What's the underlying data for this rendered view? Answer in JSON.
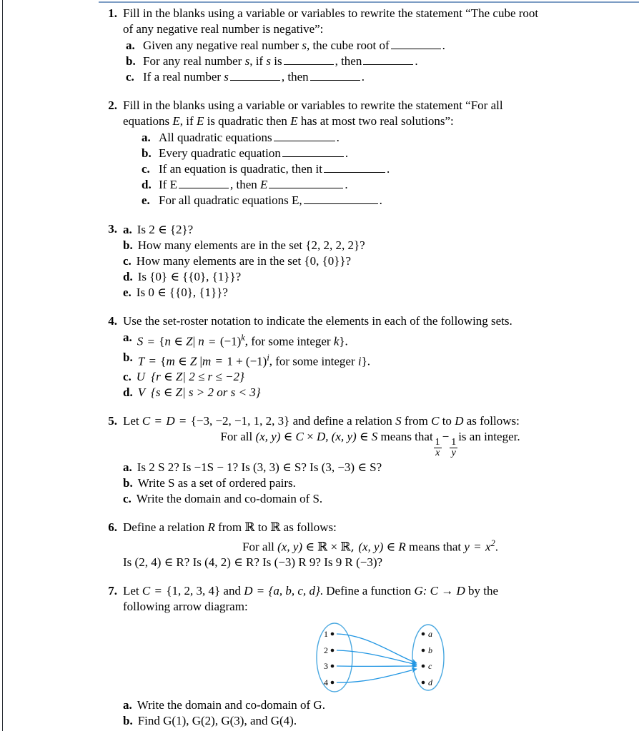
{
  "document": {
    "type": "math-worksheet",
    "rule_color": "#7d9dc4",
    "diagram_color": "#4aa8e0",
    "arrow_color": "#2196e3"
  },
  "problems": [
    {
      "number": "1.",
      "stem_line1": "Fill in the blanks using a variable or variables to rewrite the statement “The cube root",
      "stem_line2": "of any negative real number is negative”:",
      "parts": [
        {
          "label": "a.",
          "pre": "Given any negative real number",
          "var1": "s",
          "mid": ", the cube root of",
          "post": "."
        },
        {
          "label": "b.",
          "pre": "For any real number",
          "var1": "s",
          "mid": ", if",
          "var2": "s",
          "mid2": "is",
          "join": ", then",
          "post": "."
        },
        {
          "label": "c.",
          "pre": "If a real number",
          "var1": "s",
          "join": ", then",
          "post": "."
        }
      ]
    },
    {
      "number": "2.",
      "stem_line1": "Fill in the blanks using a variable or variables to rewrite the statement “For all",
      "stem_line2_a": "equations",
      "stem_line2_var1": "E",
      "stem_line2_b": ", if",
      "stem_line2_var2": "E",
      "stem_line2_c": "is quadratic then",
      "stem_line2_var3": "E",
      "stem_line2_d": "has at most two real solutions”:",
      "parts": [
        {
          "label": "a.",
          "text": "All quadratic equations",
          "post": "."
        },
        {
          "label": "b.",
          "text": "Every quadratic equation",
          "post": "."
        },
        {
          "label": "c.",
          "text": "If an equation is quadratic, then it",
          "post": "."
        },
        {
          "label": "d.",
          "text": "If E",
          "mid": ", then",
          "var": "E",
          "post": "."
        },
        {
          "label": "e.",
          "text": "For all quadratic equations E,",
          "post": "."
        }
      ]
    },
    {
      "number": "3.",
      "parts": [
        {
          "label": "a.",
          "text": "Is 2  ∈  {2}?"
        },
        {
          "label": "b.",
          "text": "How many elements are in the set {2, 2, 2, 2}?"
        },
        {
          "label": "c.",
          "text": "How many elements are in the set {0, {0}}?"
        },
        {
          "label": "d.",
          "text": "Is {0}  ∈  {{0}, {1}}?"
        },
        {
          "label": "e.",
          "text": "Is 0  ∈  {{0}, {1}}?"
        }
      ]
    },
    {
      "number": "4.",
      "stem": "Use the set-roster notation to indicate the elements in each of the following sets.",
      "parts": [
        {
          "label": "a.",
          "set": "S",
          "body_pre": "{",
          "elem": "n",
          "in": "∈",
          "univ": "Z",
          "bar": "|",
          "elem2": "n",
          "eq": "=",
          "expr": "(−1)",
          "exp": "k",
          "tail": ", for some integer",
          "tailvar": "k",
          "close": "}."
        },
        {
          "label": "b.",
          "set": "T",
          "body_pre": "{",
          "elem": "m",
          "in": "∈",
          "univ": "Z",
          "bar": "|",
          "elem2": "m",
          "eq": "=",
          "expr": "1 + (−1)",
          "exp": "i",
          "tail": ", for some integer",
          "tailvar": "i",
          "close": "}."
        },
        {
          "label": "c.",
          "set": "U",
          "body": "{r ∈ Z| 2 ≤ r ≤ −2}"
        },
        {
          "label": "d.",
          "set": "V",
          "body": "{s ∈ Z| s > 2 or s < 3}"
        }
      ]
    },
    {
      "number": "5.",
      "stem_a": "Let",
      "stem_C": "C",
      "stem_eq1": "=",
      "stem_D": "D",
      "stem_eq2": "=",
      "stem_set": "{−3, −2, −1, 1, 2, 3}",
      "stem_b": "and define a relation",
      "stem_S": "S",
      "stem_c": "from",
      "stem_C2": "C",
      "stem_d": "to",
      "stem_D2": "D",
      "stem_e": "as follows:",
      "centered_pre": "For all",
      "centered_pair": "(x, y)",
      "centered_in1": "∈",
      "centered_C": "C",
      "centered_times": "×",
      "centered_D": "D, ",
      "centered_pair2": "(x, y)",
      "centered_in2": "∈",
      "centered_S": "S",
      "centered_means": "means that",
      "frac1_num": "1",
      "frac1_den": "x",
      "frac_minus": "−",
      "frac2_num": "1",
      "frac2_den": "y",
      "centered_tail": "is an integer.",
      "parts": [
        {
          "label": "a.",
          "text": "Is 2 S 2? Is −1S  −  1? Is (3, 3)  ∈  S? Is (3, −3)  ∈  S?"
        },
        {
          "label": "b.",
          "text": "Write S as a set of ordered pairs."
        },
        {
          "label": "c.",
          "text": "Write the domain and co-domain of S."
        }
      ]
    },
    {
      "number": "6.",
      "stem_a": "Define a relation",
      "stem_R": "R",
      "stem_b": "from",
      "stem_RR1": "ℝ",
      "stem_c": "to",
      "stem_RR2": "ℝ",
      "stem_d": "as follows:",
      "centered_pre": "For all",
      "centered_pair": "(x, y)",
      "centered_in1": "∈",
      "centered_RR1": "ℝ",
      "centered_times": "×",
      "centered_RR2": "ℝ, ",
      "centered_pair2": "(x, y)",
      "centered_in2": "∈",
      "centered_R": "R",
      "centered_means": "means that",
      "centered_y": "y",
      "centered_eq": "=",
      "centered_x": "x",
      "centered_sup": "2",
      "centered_period": ".",
      "last_line": "Is (2, 4)  ∈  R? Is (4, 2)  ∈  R? Is (−3) R 9? Is 9 R (−3)?"
    },
    {
      "number": "7.",
      "stem_a": "Let",
      "stem_C": "C",
      "stem_eq1": "=",
      "stem_setC": "{1, 2, 3, 4}",
      "stem_and": "and",
      "stem_D": "D",
      "stem_eq2": "=",
      "stem_setD": "{a, b, c, d}",
      "stem_b": ". Define a function",
      "stem_G": "G: C",
      "stem_arrow": "→",
      "stem_D2": "D",
      "stem_c": "by the",
      "stem_line2": "following arrow diagram:",
      "parts": [
        {
          "label": "a.",
          "text": "Write the domain and co-domain of G."
        },
        {
          "label": "b.",
          "text": "Find G(1), G(2), G(3), and G(4)."
        }
      ]
    }
  ],
  "arrow_diagram": {
    "domain_labels": [
      "1",
      "2",
      "3",
      "4"
    ],
    "codomain_labels": [
      "a",
      "b",
      "c",
      "d"
    ],
    "mappings": [
      {
        "from": "1",
        "to": "c"
      },
      {
        "from": "2",
        "to": "c"
      },
      {
        "from": "3",
        "to": "c"
      },
      {
        "from": "4",
        "to": "c"
      }
    ]
  }
}
